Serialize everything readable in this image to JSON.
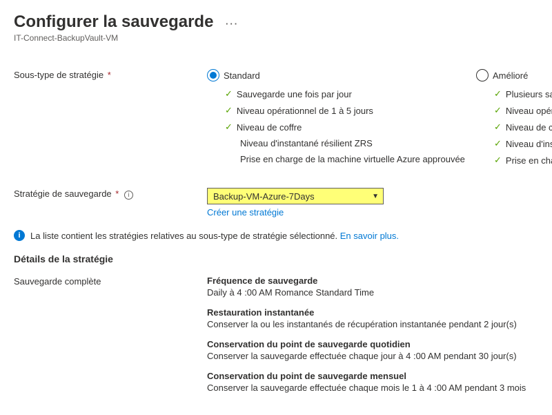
{
  "header": {
    "title": "Configurer la sauvegarde",
    "more_menu": "···",
    "subtitle": "IT-Connect-BackupVault-VM"
  },
  "subtype": {
    "label": "Sous-type de stratégie",
    "required": "*",
    "options": {
      "standard": {
        "label": "Standard",
        "features": [
          {
            "check": true,
            "text": "Sauvegarde une fois par jour"
          },
          {
            "check": true,
            "text": "Niveau opérationnel de 1 à 5 jours"
          },
          {
            "check": true,
            "text": "Niveau de coffre"
          },
          {
            "check": false,
            "text": "Niveau d'instantané résilient ZRS"
          },
          {
            "check": false,
            "text": "Prise en charge de la machine virtuelle Azure approuvée"
          }
        ]
      },
      "enhanced": {
        "label": "Amélioré",
        "features": [
          {
            "check": true,
            "text": "Plusieurs sauvegar"
          },
          {
            "check": true,
            "text": "Niveau opérationn"
          },
          {
            "check": true,
            "text": "Niveau de coffre"
          },
          {
            "check": true,
            "text": "Niveau d'instantan"
          },
          {
            "check": true,
            "text": "Prise en charge de"
          }
        ]
      }
    }
  },
  "policy": {
    "label": "Stratégie de sauvegarde",
    "required": "*",
    "selected": "Backup-VM-Azure-7Days",
    "create_link": "Créer une stratégie"
  },
  "info": {
    "text": "La liste contient les stratégies relatives au sous-type de stratégie sélectionné.",
    "learn_more": "En savoir plus."
  },
  "details": {
    "section_title": "Détails de la stratégie",
    "left_label": "Sauvegarde complète",
    "items": [
      {
        "title": "Fréquence de sauvegarde",
        "body": "Daily à 4 :00 AM Romance Standard Time"
      },
      {
        "title": "Restauration instantanée",
        "body": "Conserver la ou les instantanés de récupération instantanée pendant 2 jour(s)"
      },
      {
        "title": "Conservation du point de sauvegarde quotidien",
        "body": "Conserver la sauvegarde effectuée chaque jour à 4 :00 AM pendant 30 jour(s)"
      },
      {
        "title": "Conservation du point de sauvegarde mensuel",
        "body": "Conserver la sauvegarde effectuée chaque mois le 1 à 4 :00 AM pendant 3 mois"
      }
    ]
  }
}
